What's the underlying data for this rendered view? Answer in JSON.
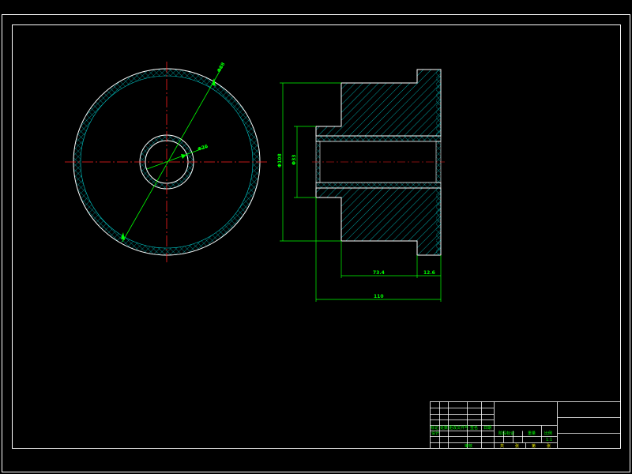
{
  "colors": {
    "background": "#000000",
    "frame": "#ffffff",
    "centerline": "#ff2020",
    "dimension": "#00ff00",
    "hatch": "#00cccc",
    "outline": "#ffffff",
    "title_text": "#00ff00",
    "title_text_alt": "#ffff00"
  },
  "front_view": {
    "outer_diameter_label": "Φ88",
    "bore_diameter_label": "Φ26"
  },
  "section_view": {
    "overall_height_label": "Φ108",
    "bore_height_label": "Φ33",
    "body_length_label": "73.4",
    "flange_length_label": "12.6",
    "overall_length_label": "110"
  },
  "title_block": {
    "sign_row": [
      "标记",
      "处数",
      "更改文件号",
      "签名",
      "日期"
    ],
    "design_label": "设计",
    "audit_label": "审核",
    "stage_label": "阶段标记",
    "weight_label": "重量",
    "scale_label": "比例",
    "scale_value": "1:1",
    "sheet_row": [
      "共",
      "张",
      "第",
      "张"
    ]
  }
}
